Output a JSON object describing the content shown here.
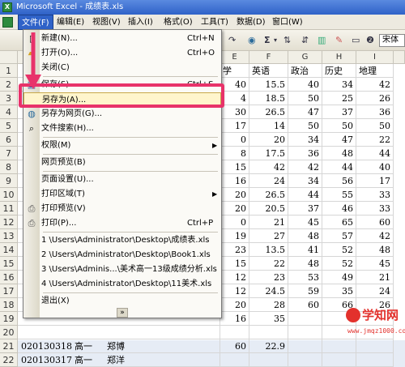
{
  "window": {
    "title": "Microsoft Excel - 成绩表.xls"
  },
  "menubar": {
    "items": [
      "文件(F)",
      "编辑(E)",
      "视图(V)",
      "插入(I)",
      "格式(O)",
      "工具(T)",
      "数据(D)",
      "窗口(W)"
    ]
  },
  "toolbar": {
    "sigma": "Σ",
    "font": "宋体"
  },
  "columns": [
    "E",
    "F",
    "G",
    "H",
    "I"
  ],
  "subjects": [
    "学",
    "英语",
    "政治",
    "历史",
    "地理"
  ],
  "rows": [
    {
      "n": "1"
    },
    {
      "n": "2",
      "e": "40",
      "f": "15.5",
      "g": "40",
      "h": "34",
      "i": "42"
    },
    {
      "n": "3",
      "e": "4",
      "f": "18.5",
      "g": "50",
      "h": "25",
      "i": "26"
    },
    {
      "n": "4",
      "e": "30",
      "f": "26.5",
      "g": "47",
      "h": "37",
      "i": "36"
    },
    {
      "n": "5",
      "e": "17",
      "f": "14",
      "g": "50",
      "h": "50",
      "i": "50"
    },
    {
      "n": "6",
      "e": "0",
      "f": "20",
      "g": "34",
      "h": "47",
      "i": "22"
    },
    {
      "n": "7",
      "e": "8",
      "f": "17.5",
      "g": "36",
      "h": "48",
      "i": "44"
    },
    {
      "n": "8",
      "e": "15",
      "f": "42",
      "g": "42",
      "h": "44",
      "i": "40"
    },
    {
      "n": "9",
      "e": "16",
      "f": "24",
      "g": "34",
      "h": "56",
      "i": "17"
    },
    {
      "n": "10",
      "e": "20",
      "f": "26.5",
      "g": "44",
      "h": "55",
      "i": "33"
    },
    {
      "n": "11",
      "e": "20",
      "f": "20.5",
      "g": "37",
      "h": "46",
      "i": "33"
    },
    {
      "n": "12",
      "e": "0",
      "f": "21",
      "g": "45",
      "h": "65",
      "i": "60"
    },
    {
      "n": "13",
      "e": "19",
      "f": "27",
      "g": "48",
      "h": "57",
      "i": "42"
    },
    {
      "n": "14",
      "e": "23",
      "f": "13.5",
      "g": "41",
      "h": "52",
      "i": "48"
    },
    {
      "n": "15",
      "e": "15",
      "f": "22",
      "g": "48",
      "h": "52",
      "i": "45"
    },
    {
      "n": "16",
      "e": "12",
      "f": "23",
      "g": "53",
      "h": "49",
      "i": "21"
    },
    {
      "n": "17",
      "e": "12",
      "f": "24.5",
      "g": "59",
      "h": "35",
      "i": "24"
    },
    {
      "n": "18",
      "e": "20",
      "f": "28",
      "g": "60",
      "h": "66",
      "i": "26"
    },
    {
      "n": "19",
      "e": "16",
      "f": "35",
      "g": "",
      "h": "",
      "": ""
    },
    {
      "n": "20",
      "e": "",
      "f": "",
      "g": "",
      "h": "",
      "i": ""
    },
    {
      "n": "21",
      "a": "020130318",
      "b": "高一",
      "c": "郑博",
      "e": "60",
      "f": "22.9",
      "g": "",
      "h": "",
      "i": ""
    },
    {
      "n": "22",
      "a": "020130317",
      "b": "高一",
      "c": "郑洋",
      "e": "",
      "f": "",
      "g": "",
      "h": "",
      "i": ""
    }
  ],
  "file_menu": {
    "items": [
      {
        "label": "新建(N)...",
        "shortcut": "Ctrl+N",
        "icon": "new-doc-icon"
      },
      {
        "label": "打开(O)...",
        "shortcut": "Ctrl+O",
        "icon": "open-folder-icon"
      },
      {
        "label": "关闭(C)",
        "shortcut": "",
        "icon": ""
      },
      {
        "label": "保存(S)",
        "shortcut": "Ctrl+S",
        "icon": "save-icon"
      },
      {
        "label": "另存为(A)...",
        "shortcut": "",
        "icon": ""
      },
      {
        "label": "另存为网页(G)...",
        "shortcut": "",
        "icon": "web-save-icon"
      },
      {
        "label": "文件搜索(H)...",
        "shortcut": "",
        "icon": "search-file-icon"
      },
      {
        "label": "权限(M)",
        "shortcut": "",
        "icon": ""
      },
      {
        "label": "网页预览(B)",
        "shortcut": "",
        "icon": ""
      },
      {
        "label": "页面设置(U)...",
        "shortcut": "",
        "icon": ""
      },
      {
        "label": "打印区域(T)",
        "shortcut": "",
        "icon": ""
      },
      {
        "label": "打印预览(V)",
        "shortcut": "",
        "icon": "print-preview-icon"
      },
      {
        "label": "打印(P)...",
        "shortcut": "Ctrl+P",
        "icon": "print-icon"
      },
      {
        "label": "1 \\Users\\Administrator\\Desktop\\成绩表.xls",
        "shortcut": "",
        "icon": ""
      },
      {
        "label": "2 \\Users\\Administrator\\Desktop\\Book1.xls",
        "shortcut": "",
        "icon": ""
      },
      {
        "label": "3 \\Users\\Adminis...\\美术高一13级成绩分析.xls",
        "shortcut": "",
        "icon": ""
      },
      {
        "label": "4 \\Users\\Administrator\\Desktop\\11美术.xls",
        "shortcut": "",
        "icon": ""
      },
      {
        "label": "退出(X)",
        "shortcut": "",
        "icon": ""
      }
    ],
    "expand": "»"
  },
  "watermark": {
    "title": "学知网",
    "url": "www.jmqz1000.com"
  },
  "colors": {
    "highlight_border": "#e8326a",
    "menu_active": "#2f62c8",
    "watermark": "#e3312c"
  }
}
